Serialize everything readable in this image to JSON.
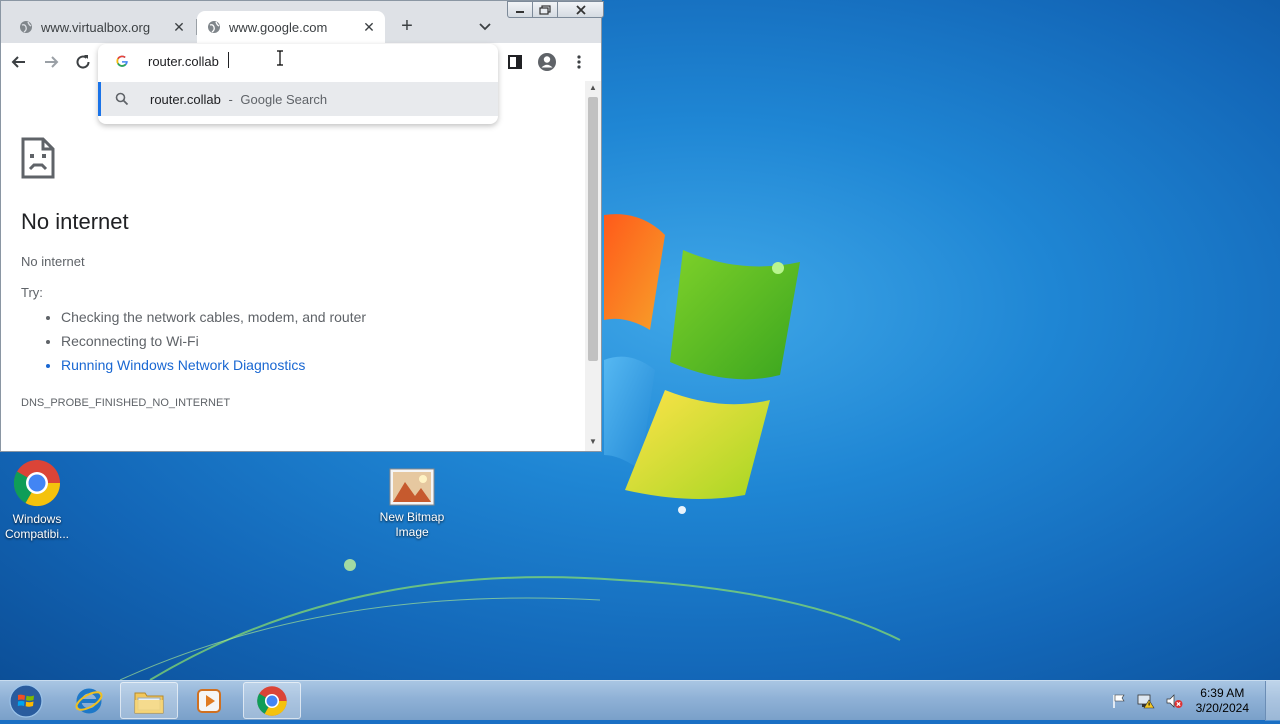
{
  "browser": {
    "tabs": [
      {
        "title": "www.virtualbox.org",
        "active": false
      },
      {
        "title": "www.google.com",
        "active": true
      }
    ],
    "newtab_symbol": "+",
    "close_symbol": "✕",
    "omnibox": {
      "value": "router.collab",
      "suggestion_query": "router.collab",
      "suggestion_separator": "-",
      "suggestion_type": "Google Search"
    }
  },
  "page": {
    "title": "No internet",
    "subtitle": "No internet",
    "try_label": "Try:",
    "suggestions": [
      "Checking the network cables, modem, and router",
      "Reconnecting to Wi-Fi",
      "Running Windows Network Diagnostics"
    ],
    "error_code": "DNS_PROBE_FINISHED_NO_INTERNET"
  },
  "desktop": {
    "icons": [
      {
        "label": "Windows Compatibi..."
      },
      {
        "label": "New Bitmap Image"
      }
    ]
  },
  "taskbar": {
    "clock_time": "6:39 AM",
    "clock_date": "3/20/2024"
  },
  "colors": {
    "accent": "#1a73e8",
    "link": "#1967d2",
    "desktop_bg": "#1f86d4"
  }
}
